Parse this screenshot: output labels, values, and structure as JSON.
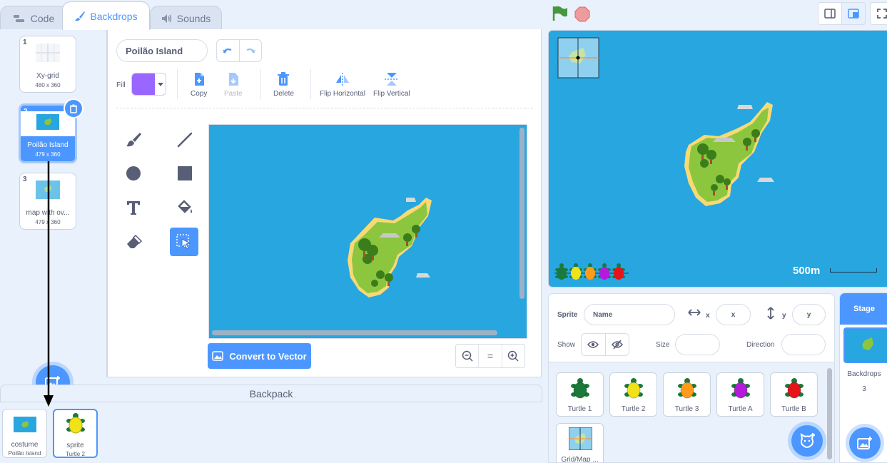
{
  "tabs": [
    {
      "label": "Code",
      "icon": "code-icon"
    },
    {
      "label": "Backdrops",
      "icon": "brush-icon"
    },
    {
      "label": "Sounds",
      "icon": "speaker-icon"
    }
  ],
  "costumes": [
    {
      "number": "1",
      "name": "Xy-grid",
      "size": "480 x 360"
    },
    {
      "number": "2",
      "name": "Poilão Island",
      "size": "479 x 360",
      "selected": true
    },
    {
      "number": "3",
      "name": "map with ov...",
      "size": "479 x 360"
    }
  ],
  "editor": {
    "costume_name": "Poilão Island",
    "fill_label": "Fill",
    "fill_color": "#9966ff",
    "tools": {
      "copy": "Copy",
      "paste": "Paste",
      "delete": "Delete",
      "flip_h": "Flip Horizontal",
      "flip_v": "Flip Vertical"
    },
    "convert_label": "Convert to Vector",
    "zoom_reset": "="
  },
  "backpack": {
    "title": "Backpack",
    "items": [
      {
        "name": "costume",
        "sub": "Poilão Island"
      },
      {
        "name": "sprite",
        "sub": "Turtle 2"
      }
    ]
  },
  "stage": {
    "scale_label": "500m",
    "turtle_colors": [
      "#1a7a3a",
      "#f2e21a",
      "#ff9a1a",
      "#b41ad9",
      "#e6141a"
    ]
  },
  "sprite_info": {
    "sprite_label": "Sprite",
    "name_placeholder": "Name",
    "x_label": "x",
    "x_placeholder": "x",
    "y_label": "y",
    "y_placeholder": "y",
    "show_label": "Show",
    "size_label": "Size",
    "direction_label": "Direction"
  },
  "sprites": [
    {
      "name": "Turtle 1",
      "color": "#1a7a3a"
    },
    {
      "name": "Turtle 2",
      "color": "#f2e21a"
    },
    {
      "name": "Turtle 3",
      "color": "#ff9a1a"
    },
    {
      "name": "Turtle A",
      "color": "#b41ad9"
    },
    {
      "name": "Turtle B",
      "color": "#e6141a"
    },
    {
      "name": "Grid/Map ..."
    }
  ],
  "stage_selector": {
    "title": "Stage",
    "backdrops_label": "Backdrops",
    "backdrops_count": "3"
  },
  "colors": {
    "accent": "#4c97ff",
    "water": "#28a6e0",
    "island": "#8cc63f"
  }
}
